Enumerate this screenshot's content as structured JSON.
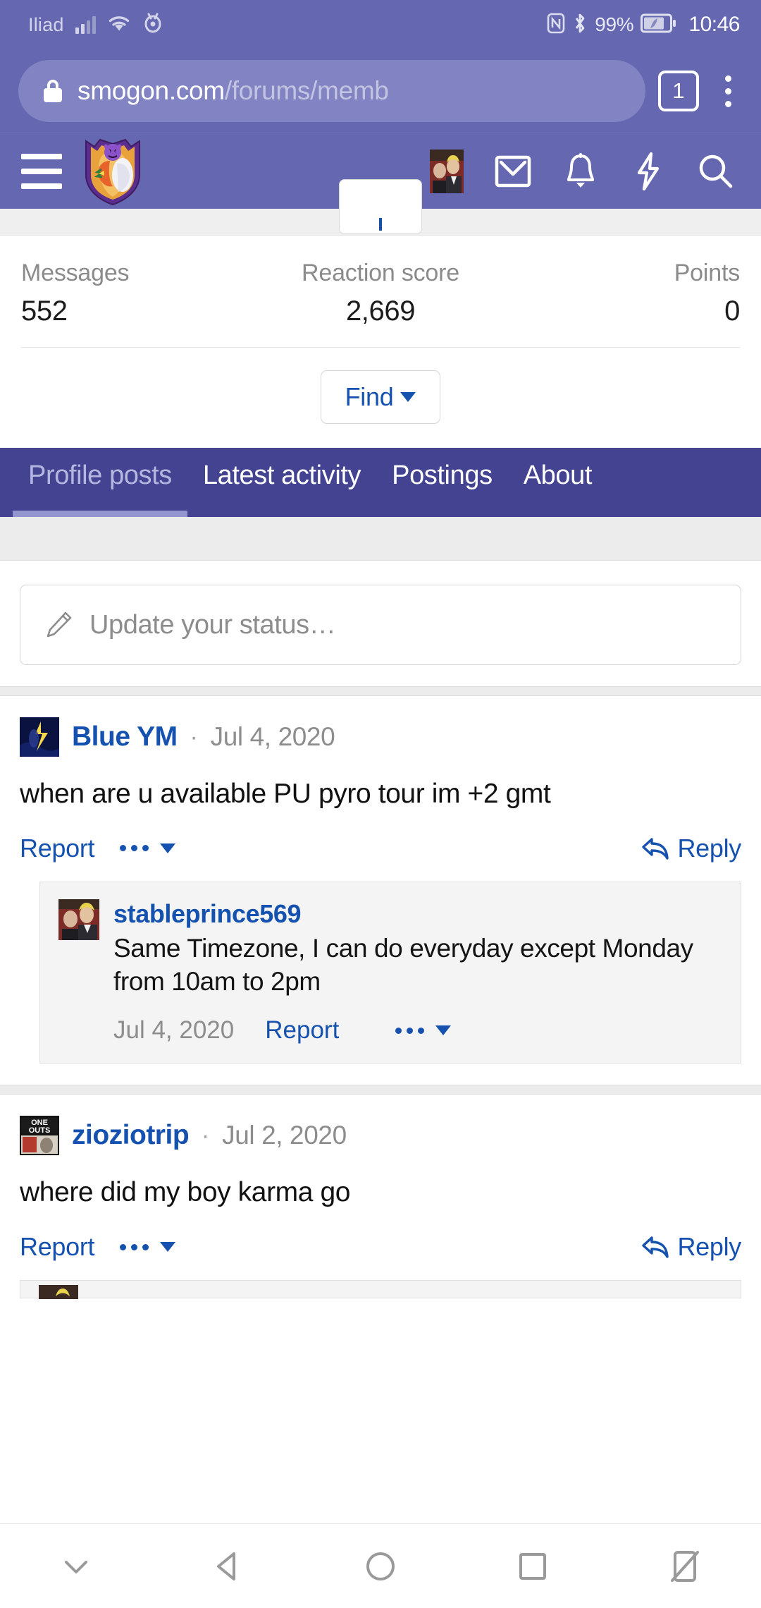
{
  "status_bar": {
    "carrier": "Iliad",
    "battery_percent": "99%",
    "time": "10:46",
    "icons": [
      "signal-icon",
      "wifi-icon",
      "eye-care-icon",
      "nfc-icon",
      "bluetooth-icon",
      "battery-icon"
    ]
  },
  "browser": {
    "url_host": "smogon.com",
    "url_path": "/forums/memb",
    "tab_count": "1",
    "lock_icon": "lock-icon",
    "menu_icon": "kebab-menu-icon"
  },
  "forum_header": {
    "menu_icon": "hamburger-menu-icon",
    "logo_icon": "smogon-shield-logo",
    "avatar_icon": "user-avatar",
    "inbox_icon": "envelope-icon",
    "alerts_icon": "bell-icon",
    "bolt_icon": "lightning-bolt-icon",
    "search_icon": "search-icon"
  },
  "stats": [
    {
      "label": "Messages",
      "value": "552"
    },
    {
      "label": "Reaction score",
      "value": "2,669"
    },
    {
      "label": "Points",
      "value": "0"
    }
  ],
  "find_button": {
    "label": "Find",
    "caret": "chevron-down-icon"
  },
  "tabs": [
    {
      "label": "Profile posts",
      "active": true
    },
    {
      "label": "Latest activity",
      "active": false
    },
    {
      "label": "Postings",
      "active": false
    },
    {
      "label": "About",
      "active": false
    }
  ],
  "status_update": {
    "placeholder": "Update your status…",
    "icon": "pencil-icon"
  },
  "posts": [
    {
      "author": "Blue YM",
      "separator": "·",
      "date": "Jul 4, 2020",
      "body": "when are u available PU pyro tour im +2 gmt",
      "actions": {
        "report": "Report",
        "more": "more-options-icon",
        "reply": "Reply",
        "reply_icon": "reply-arrow-icon"
      },
      "replies": [
        {
          "author": "stableprince569",
          "text": "Same Timezone, I can do everyday except Monday from 10am to 2pm",
          "date": "Jul 4, 2020",
          "report": "Report",
          "more": "more-options-icon"
        }
      ]
    },
    {
      "author": "zioziotrip",
      "separator": "·",
      "date": "Jul 2, 2020",
      "body": "where did my boy karma go",
      "actions": {
        "report": "Report",
        "more": "more-options-icon",
        "reply": "Reply",
        "reply_icon": "reply-arrow-icon"
      },
      "replies": []
    }
  ],
  "nav_bar": {
    "items": [
      "hide-keyboard-icon",
      "back-icon",
      "home-icon",
      "recents-icon",
      "rotate-screen-icon"
    ]
  },
  "colors": {
    "browser_chrome": "#6567b0",
    "url_pill": "#8183c2",
    "tab_bar": "#434391",
    "tab_active_underline": "#9395ce",
    "link_blue": "#1552b0",
    "muted_text": "#8d8d8d"
  }
}
